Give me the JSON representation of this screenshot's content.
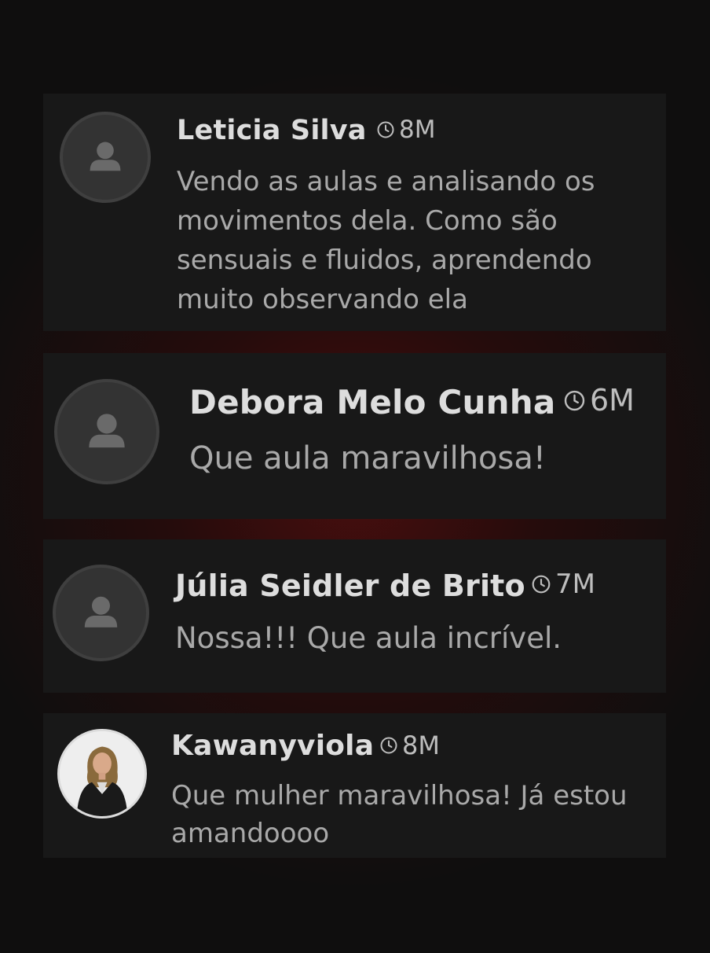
{
  "comments": [
    {
      "author": "Leticia Silva",
      "time": "8M",
      "text": "Vendo as aulas e analisando os movimentos dela. Como são sensuais e fluidos, aprendendo muito observando ela",
      "avatar": "default-user-avatar-icon"
    },
    {
      "author": "Debora Melo Cunha",
      "time": "6M",
      "text": "Que aula maravilhosa!",
      "avatar": "default-user-avatar-icon"
    },
    {
      "author": "Júlia Seidler de Brito",
      "time": "7M",
      "text": "Nossa!!! Que aula incrível.",
      "avatar": "default-user-avatar-icon"
    },
    {
      "author": "Kawanyviola",
      "time": "8M",
      "text": "Que mulher maravilhosa! Já estou amandoooo",
      "avatar": "user-photo-avatar"
    }
  ],
  "colors": {
    "background": "#0f0e0e",
    "glow": "#780e0e",
    "card": "#181818",
    "name": "#dddddd",
    "text": "#a9a9a9"
  }
}
